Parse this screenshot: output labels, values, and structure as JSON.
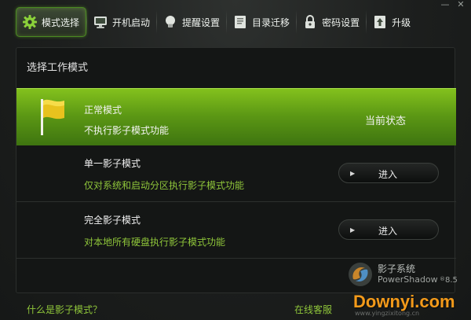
{
  "window": {
    "minimize_label": "—",
    "close_label": "✕"
  },
  "toolbar": {
    "tabs": [
      {
        "label": "模式选择",
        "icon": "gear-icon"
      },
      {
        "label": "开机启动",
        "icon": "monitor-icon"
      },
      {
        "label": "提醒设置",
        "icon": "lightbulb-icon"
      },
      {
        "label": "目录迁移",
        "icon": "folder-icon"
      },
      {
        "label": "密码设置",
        "icon": "lock-icon"
      },
      {
        "label": "升级",
        "icon": "upgrade-icon"
      }
    ],
    "active_index": 0
  },
  "panel": {
    "title": "选择工作模式",
    "modes": [
      {
        "name": "正常模式",
        "description": "不执行影子模式功能",
        "status": "当前状态"
      },
      {
        "name": "单一影子模式",
        "description": "仅对系统和启动分区执行影子模式功能",
        "button": "进入"
      },
      {
        "name": "完全影子模式",
        "description": "对本地所有硬盘执行影子模式功能",
        "button": "进入"
      }
    ]
  },
  "brand": {
    "name": "影子系统",
    "sub": "PowerShadow",
    "version": "8.5",
    "registered": "®"
  },
  "footer": {
    "help_link": "什么是影子模式？",
    "online_link": "在线客服"
  },
  "watermark": {
    "text": "Downyi.com",
    "sub": "www.yingzixitong.cn"
  },
  "colors": {
    "accent_green": "#8fc63a",
    "active_row_top": "#83c11d",
    "active_row_bottom": "#3e7410",
    "flag_yellow": "#e8c21e",
    "watermark_orange": "#f39a1a"
  }
}
